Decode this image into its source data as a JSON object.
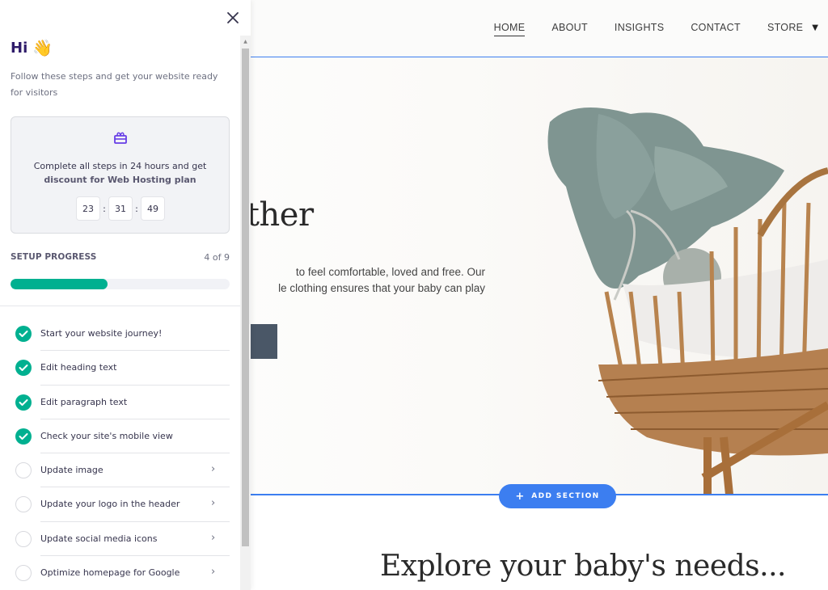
{
  "site": {
    "nav": [
      {
        "label": "HOME",
        "active": true
      },
      {
        "label": "ABOUT",
        "active": false
      },
      {
        "label": "INSIGHTS",
        "active": false
      },
      {
        "label": "CONTACT",
        "active": false
      },
      {
        "label": "STORE",
        "active": false
      }
    ],
    "store_caret": "▼",
    "hero": {
      "title": "Together",
      "text_line1": "to feel comfortable, loved and free. Our",
      "text_line2": "le clothing ensures that your baby can play"
    },
    "add_section": {
      "icon": "+",
      "label": "ADD SECTION"
    },
    "explore_title": "Explore your baby's needs...",
    "accent_color": "#3c7ef0"
  },
  "panel": {
    "close_icon": "✕",
    "greeting": "Hi",
    "greeting_emoji": "👋",
    "intro": "Follow these steps and get your website ready for visitors",
    "promo": {
      "line1": "Complete all steps in 24 hours and get",
      "line2": "discount for Web Hosting plan",
      "timer": {
        "hours": "23",
        "minutes": "31",
        "seconds": "49"
      },
      "separator": ":"
    },
    "progress": {
      "label": "SETUP PROGRESS",
      "count_text": "4 of 9",
      "completed": 4,
      "total": 9,
      "color": "#00b090"
    },
    "steps": [
      {
        "label": "Start your website journey!",
        "done": true
      },
      {
        "label": "Edit heading text",
        "done": true
      },
      {
        "label": "Edit paragraph text",
        "done": true
      },
      {
        "label": "Check your site's mobile view",
        "done": true
      },
      {
        "label": "Update image",
        "done": false
      },
      {
        "label": "Update your logo in the header",
        "done": false
      },
      {
        "label": "Update social media icons",
        "done": false
      },
      {
        "label": "Optimize homepage for Google",
        "done": false
      }
    ],
    "chevron": "›"
  }
}
